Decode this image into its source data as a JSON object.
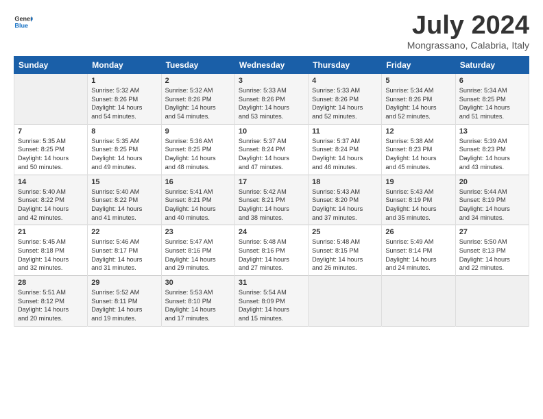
{
  "logo": {
    "line1": "General",
    "line2": "Blue"
  },
  "title": "July 2024",
  "location": "Mongrassano, Calabria, Italy",
  "headers": [
    "Sunday",
    "Monday",
    "Tuesday",
    "Wednesday",
    "Thursday",
    "Friday",
    "Saturday"
  ],
  "weeks": [
    [
      {
        "num": "",
        "empty": true
      },
      {
        "num": "1",
        "info": "Sunrise: 5:32 AM\nSunset: 8:26 PM\nDaylight: 14 hours\nand 54 minutes."
      },
      {
        "num": "2",
        "info": "Sunrise: 5:32 AM\nSunset: 8:26 PM\nDaylight: 14 hours\nand 54 minutes."
      },
      {
        "num": "3",
        "info": "Sunrise: 5:33 AM\nSunset: 8:26 PM\nDaylight: 14 hours\nand 53 minutes."
      },
      {
        "num": "4",
        "info": "Sunrise: 5:33 AM\nSunset: 8:26 PM\nDaylight: 14 hours\nand 52 minutes."
      },
      {
        "num": "5",
        "info": "Sunrise: 5:34 AM\nSunset: 8:26 PM\nDaylight: 14 hours\nand 52 minutes."
      },
      {
        "num": "6",
        "info": "Sunrise: 5:34 AM\nSunset: 8:25 PM\nDaylight: 14 hours\nand 51 minutes."
      }
    ],
    [
      {
        "num": "7",
        "info": "Sunrise: 5:35 AM\nSunset: 8:25 PM\nDaylight: 14 hours\nand 50 minutes."
      },
      {
        "num": "8",
        "info": "Sunrise: 5:35 AM\nSunset: 8:25 PM\nDaylight: 14 hours\nand 49 minutes."
      },
      {
        "num": "9",
        "info": "Sunrise: 5:36 AM\nSunset: 8:25 PM\nDaylight: 14 hours\nand 48 minutes."
      },
      {
        "num": "10",
        "info": "Sunrise: 5:37 AM\nSunset: 8:24 PM\nDaylight: 14 hours\nand 47 minutes."
      },
      {
        "num": "11",
        "info": "Sunrise: 5:37 AM\nSunset: 8:24 PM\nDaylight: 14 hours\nand 46 minutes."
      },
      {
        "num": "12",
        "info": "Sunrise: 5:38 AM\nSunset: 8:23 PM\nDaylight: 14 hours\nand 45 minutes."
      },
      {
        "num": "13",
        "info": "Sunrise: 5:39 AM\nSunset: 8:23 PM\nDaylight: 14 hours\nand 43 minutes."
      }
    ],
    [
      {
        "num": "14",
        "info": "Sunrise: 5:40 AM\nSunset: 8:22 PM\nDaylight: 14 hours\nand 42 minutes."
      },
      {
        "num": "15",
        "info": "Sunrise: 5:40 AM\nSunset: 8:22 PM\nDaylight: 14 hours\nand 41 minutes."
      },
      {
        "num": "16",
        "info": "Sunrise: 5:41 AM\nSunset: 8:21 PM\nDaylight: 14 hours\nand 40 minutes."
      },
      {
        "num": "17",
        "info": "Sunrise: 5:42 AM\nSunset: 8:21 PM\nDaylight: 14 hours\nand 38 minutes."
      },
      {
        "num": "18",
        "info": "Sunrise: 5:43 AM\nSunset: 8:20 PM\nDaylight: 14 hours\nand 37 minutes."
      },
      {
        "num": "19",
        "info": "Sunrise: 5:43 AM\nSunset: 8:19 PM\nDaylight: 14 hours\nand 35 minutes."
      },
      {
        "num": "20",
        "info": "Sunrise: 5:44 AM\nSunset: 8:19 PM\nDaylight: 14 hours\nand 34 minutes."
      }
    ],
    [
      {
        "num": "21",
        "info": "Sunrise: 5:45 AM\nSunset: 8:18 PM\nDaylight: 14 hours\nand 32 minutes."
      },
      {
        "num": "22",
        "info": "Sunrise: 5:46 AM\nSunset: 8:17 PM\nDaylight: 14 hours\nand 31 minutes."
      },
      {
        "num": "23",
        "info": "Sunrise: 5:47 AM\nSunset: 8:16 PM\nDaylight: 14 hours\nand 29 minutes."
      },
      {
        "num": "24",
        "info": "Sunrise: 5:48 AM\nSunset: 8:16 PM\nDaylight: 14 hours\nand 27 minutes."
      },
      {
        "num": "25",
        "info": "Sunrise: 5:48 AM\nSunset: 8:15 PM\nDaylight: 14 hours\nand 26 minutes."
      },
      {
        "num": "26",
        "info": "Sunrise: 5:49 AM\nSunset: 8:14 PM\nDaylight: 14 hours\nand 24 minutes."
      },
      {
        "num": "27",
        "info": "Sunrise: 5:50 AM\nSunset: 8:13 PM\nDaylight: 14 hours\nand 22 minutes."
      }
    ],
    [
      {
        "num": "28",
        "info": "Sunrise: 5:51 AM\nSunset: 8:12 PM\nDaylight: 14 hours\nand 20 minutes."
      },
      {
        "num": "29",
        "info": "Sunrise: 5:52 AM\nSunset: 8:11 PM\nDaylight: 14 hours\nand 19 minutes."
      },
      {
        "num": "30",
        "info": "Sunrise: 5:53 AM\nSunset: 8:10 PM\nDaylight: 14 hours\nand 17 minutes."
      },
      {
        "num": "31",
        "info": "Sunrise: 5:54 AM\nSunset: 8:09 PM\nDaylight: 14 hours\nand 15 minutes."
      },
      {
        "num": "",
        "empty": true
      },
      {
        "num": "",
        "empty": true
      },
      {
        "num": "",
        "empty": true
      }
    ]
  ]
}
